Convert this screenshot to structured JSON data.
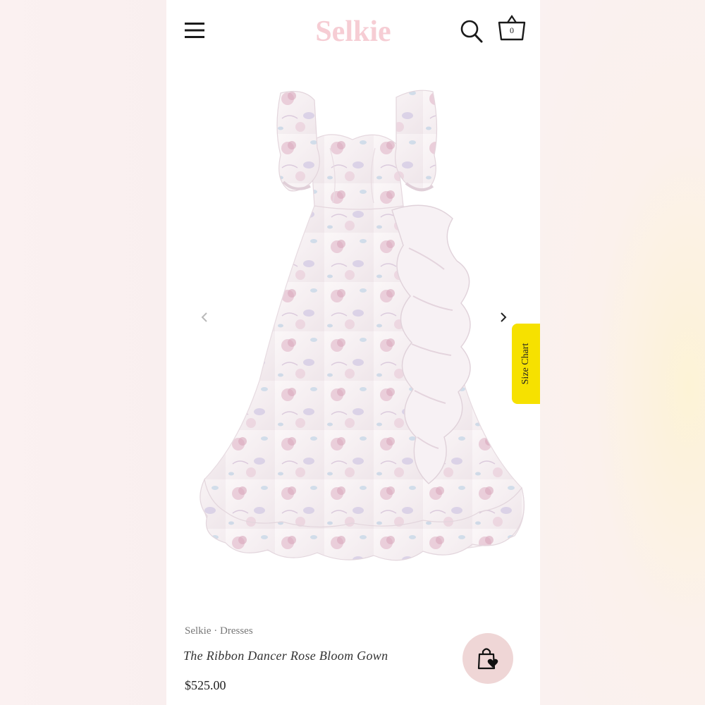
{
  "header": {
    "logo_text": "Selkie",
    "cart_count": "0",
    "icons": [
      "hamburger-menu-icon",
      "search-icon",
      "shopping-basket-icon"
    ]
  },
  "gallery": {
    "prev_icon": "chevron-left-icon",
    "next_icon": "chevron-right-icon"
  },
  "size_chart": {
    "label": "Size Chart",
    "color": "#f6e100"
  },
  "product": {
    "brand": "Selkie",
    "separator": "·",
    "category": "Dresses",
    "title": "The Ribbon Dancer Rose Bloom Gown",
    "price": "$525.00"
  },
  "fab": {
    "icon": "shopping-bag-heart-icon",
    "color": "#efd6d6"
  },
  "colors": {
    "logo": "#f6cdd4",
    "dress_base": "#f6f0f2",
    "floral_pink": "#d9a9bc",
    "floral_lilac": "#b7aed7",
    "floral_blue": "#a9c6de"
  }
}
